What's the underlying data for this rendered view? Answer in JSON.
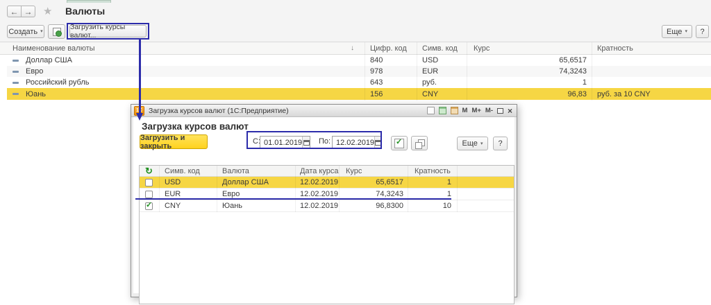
{
  "colors": {
    "annotation_blue": "#2c2caa",
    "selection_yellow": "#f6d644",
    "action_yellow": "#ffd21e"
  },
  "icons": {
    "back": "←",
    "forward": "→",
    "star": "★",
    "dropdown": "▾",
    "sort_down": "↓",
    "refresh": "↻",
    "check": "✓",
    "close": "×",
    "help": "?"
  },
  "main": {
    "nav": {
      "title": "Валюты"
    },
    "toolbar": {
      "create_label": "Создать",
      "load_rates_label": "Загрузить курсы валют...",
      "more_label": "Еще",
      "help_label": "?"
    },
    "table": {
      "headers": {
        "name": "Наименование валюты",
        "num_code": "Цифр. код",
        "sym_code": "Симв. код",
        "rate": "Курс",
        "multiplicity": "Кратность"
      },
      "rows": [
        {
          "name": "Доллар США",
          "num_code": "840",
          "sym_code": "USD",
          "rate": "65,6517",
          "multiplicity": ""
        },
        {
          "name": "Евро",
          "num_code": "978",
          "sym_code": "EUR",
          "rate": "74,3243",
          "multiplicity": ""
        },
        {
          "name": "Российский рубль",
          "num_code": "643",
          "sym_code": "руб.",
          "rate": "1",
          "multiplicity": ""
        },
        {
          "name": "Юань",
          "num_code": "156",
          "sym_code": "CNY",
          "rate": "96,83",
          "multiplicity": "руб. за 10 CNY"
        }
      ]
    }
  },
  "dialog": {
    "titlebar": {
      "title": "Загрузка курсов валют  (1С:Предприятие)",
      "logo": "1С",
      "m": "М",
      "m_plus": "М+",
      "m_minus": "М-"
    },
    "heading": "Загрузка курсов валют",
    "toolbar": {
      "load_close_label": "Загрузить и закрыть",
      "from_label": "С:",
      "from_value": "01.01.2019",
      "to_label": "По:",
      "to_value": "12.02.2019",
      "more_label": "Еще",
      "help_label": "?"
    },
    "table": {
      "headers": {
        "sym_code": "Симв. код",
        "currency": "Валюта",
        "rate_date": "Дата курса",
        "rate": "Курс",
        "multiplicity": "Кратность"
      },
      "rows": [
        {
          "checked": false,
          "sym_code": "USD",
          "currency": "Доллар США",
          "rate_date": "12.02.2019",
          "rate": "65,6517",
          "multiplicity": "1"
        },
        {
          "checked": false,
          "sym_code": "EUR",
          "currency": "Евро",
          "rate_date": "12.02.2019",
          "rate": "74,3243",
          "multiplicity": "1"
        },
        {
          "checked": true,
          "sym_code": "CNY",
          "currency": "Юань",
          "rate_date": "12.02.2019",
          "rate": "96,8300",
          "multiplicity": "10"
        }
      ]
    }
  }
}
